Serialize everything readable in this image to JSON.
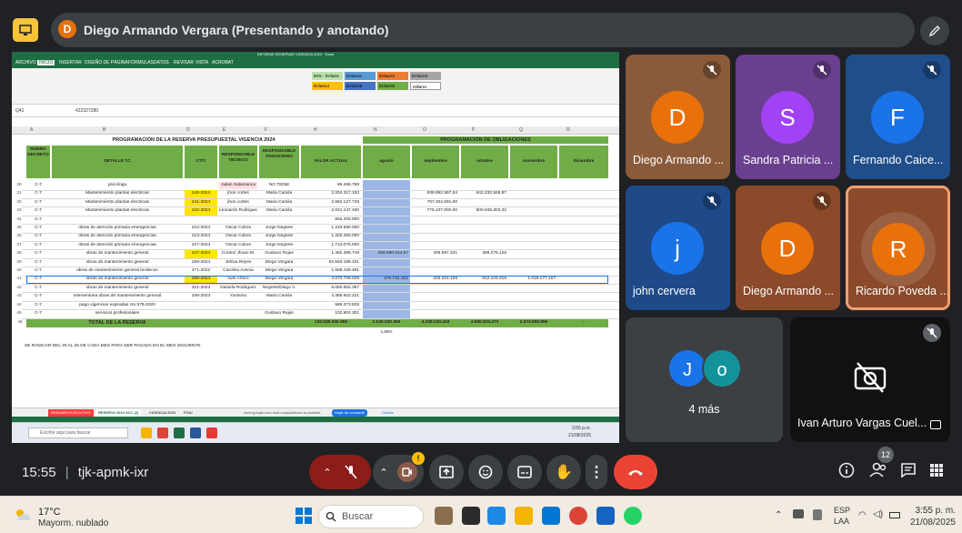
{
  "presenter": {
    "initial": "D",
    "text": "Diego Armando Vergara (Presentando y anotando)"
  },
  "excel": {
    "window_title": "INFORME RESERVAS VIGENCIA 2024 · Excel",
    "tabs": [
      "ARCHIVO",
      "INICIO",
      "INSERTAR",
      "DISEÑO DE PÁGINA",
      "FÓRMULAS",
      "DATOS",
      "REVISAR",
      "VISTA",
      "ACROBAT"
    ],
    "cell_ref": "Q41",
    "formula": "422327280",
    "styles": [
      {
        "label": "60% - Énfasis",
        "color": "#b9e1a9"
      },
      {
        "label": "Énfasis1",
        "color": "#5b9bd5"
      },
      {
        "label": "Énfasis2",
        "color": "#ed7d31"
      },
      {
        "label": "Énfasis3",
        "color": "#a5a5a5"
      },
      {
        "label": "Énfasis4",
        "color": "#ffc000"
      },
      {
        "label": "Énfasis5",
        "color": "#4472c4"
      },
      {
        "label": "Énfasis6",
        "color": "#70ad47"
      },
      {
        "label": "Millares",
        "color": "#ffffff"
      }
    ],
    "columns": [
      "A",
      "B",
      "D",
      "E",
      "F",
      "H",
      "N",
      "O",
      "P",
      "Q",
      "R"
    ],
    "title_left": "PROGRAMACIÓN DE LA RESERVA PRESUPUESTAL VIGENCIA 2024",
    "title_right": "PROGRAMACIÓN DE OBLIGACIONES",
    "headers": {
      "rubro": "RUBRO DECRETO",
      "detalle": "DETALLE TC",
      "cto": "CTO",
      "resp_tec": "RESPONSABLE TECNICO",
      "resp_fin": "RESPONSABLE FINANCIERO",
      "valor": "VALOR ACTUAL",
      "agosto": "agosto",
      "septiembre": "septiembre",
      "octubre": "octubre",
      "noviembre": "noviembre",
      "diciembre": "diciembre"
    },
    "rows": [
      {
        "n": "30",
        "rubro": "C-7",
        "detalle": "psicologa",
        "cto": "",
        "tec": "Julian Salamanca",
        "fin": "NO TIENE",
        "valor": "86.499.759",
        "ago": "",
        "sep": "",
        "oct": "",
        "nov": "",
        "dic": "",
        "hl": "red"
      },
      {
        "n": "31",
        "rubro": "C-7",
        "detalle": "Mantenimiento plantas electricas",
        "cto": "240-2024",
        "tec": "jhon cortes",
        "fin": "Maria Camila",
        "valor": "2.204.317.153",
        "ago": "",
        "sep": "638.892.557,54",
        "oct": "642.233.565,97",
        "nov": "",
        "dic": "",
        "hl": "yellow"
      },
      {
        "n": "32",
        "rubro": "C-7",
        "detalle": "Mantenimiento plantas electricas",
        "cto": "241-2024",
        "tec": "jhon cortes",
        "fin": "Maria Camila",
        "valor": "2.662.127.729",
        "ago": "",
        "sep": "797.304.591,00",
        "oct": "",
        "nov": "",
        "dic": "",
        "hl": "yellow"
      },
      {
        "n": "33",
        "rubro": "C-7",
        "detalle": "Mantenimiento plantas electricas",
        "cto": "242-2024",
        "tec": "Leonardo Rodriguez",
        "fin": "Maria Camila",
        "valor": "2.021.147.450",
        "ago": "",
        "sep": "776.107.000,00",
        "oct": "600.948.303,32",
        "nov": "",
        "dic": "",
        "hl": "yellow"
      },
      {
        "n": "34",
        "rubro": "C-7",
        "detalle": "",
        "cto": "",
        "tec": "",
        "fin": "",
        "valor": "663.200.000",
        "ago": "",
        "sep": "",
        "oct": "",
        "nov": "",
        "dic": "",
        "hl": ""
      },
      {
        "n": "35",
        "rubro": "C-7",
        "detalle": "obras de atención primaria emergencias",
        "cto": "212-2024",
        "tec": "Oscar Cobos",
        "fin": "Jorge Negrete",
        "valor": "1.233.590.000",
        "ago": "",
        "sep": "",
        "oct": "",
        "nov": "",
        "dic": "",
        "hl": ""
      },
      {
        "n": "36",
        "rubro": "C-7",
        "detalle": "obras de atención primaria emergencias",
        "cto": "213-2024",
        "tec": "Oscar Cobos",
        "fin": "Jorge Negrete",
        "valor": "1.202.250.000",
        "ago": "",
        "sep": "",
        "oct": "",
        "nov": "",
        "dic": "",
        "hl": ""
      },
      {
        "n": "37",
        "rubro": "C-7",
        "detalle": "obras de atención primaria emergencias",
        "cto": "217-2024",
        "tec": "Oscar Cobos",
        "fin": "Jorge Negrete",
        "valor": "1.713.075.000",
        "ago": "",
        "sep": "",
        "oct": "",
        "nov": "",
        "dic": "",
        "hl": ""
      },
      {
        "n": "38",
        "rubro": "C-7",
        "detalle": "obras de mantenimiento general",
        "cto": "247-2024",
        "tec": "Cortes/ Jhoan M.",
        "fin": "Gustavo Rojas",
        "valor": "1.482.386.749",
        "ago": "258.560.014,57",
        "sep": "406.597.321",
        "oct": "359.275.126",
        "nov": "",
        "dic": "",
        "hl": "yellow"
      },
      {
        "n": "39",
        "rubro": "C-7",
        "detalle": "obras de mantenimiento general",
        "cto": "259-2024",
        "tec": "Jehiva Reyes",
        "fin": "Diego Vergara",
        "valor": "53.593.188.331",
        "ago": "",
        "sep": "",
        "oct": "",
        "nov": "",
        "dic": "",
        "hl": ""
      },
      {
        "n": "40",
        "rubro": "C-7",
        "detalle": "obras de mantenimiento general fondecun",
        "cto": "271-2022",
        "tec": "Carolina Avenai",
        "fin": "Diego Vergara",
        "valor": "1.609.439.481",
        "ago": "",
        "sep": "",
        "oct": "",
        "nov": "",
        "dic": "",
        "hl": ""
      },
      {
        "n": "41",
        "rubro": "C-7",
        "detalle": "obras de mantenimiento general",
        "cto": "288-2024",
        "tec": "Ivan Arturo",
        "fin": "Diego Vergara",
        "valor": "4.070.708.029",
        "ago": "576.731.322",
        "sep": "433.324.109",
        "oct": "612.103.316",
        "nov": "1.018.177.157",
        "dic": "",
        "hl": "yellow"
      },
      {
        "n": "42",
        "rubro": "C-7",
        "detalle": "obras de mantenimiento general",
        "cto": "321-2023",
        "tec": "Daniela Rodriguez",
        "fin": "Negrete/Diego V.",
        "valor": "8.050.652.357",
        "ago": "",
        "sep": "",
        "oct": "",
        "nov": "",
        "dic": "",
        "hl": ""
      },
      {
        "n": "43",
        "rubro": "C-7",
        "detalle": "interventoria obras de mantenimiento general",
        "cto": "346-2023",
        "tec": "Yunismo",
        "fin": "Maria Camila",
        "valor": "4.365.922.221",
        "ago": "",
        "sep": "",
        "oct": "",
        "nov": "",
        "dic": "",
        "hl": ""
      },
      {
        "n": "44",
        "rubro": "C-7",
        "detalle": "pago vigencias expiradas cto 579-2020",
        "cto": "",
        "tec": "",
        "fin": "",
        "valor": "569.373.825",
        "ago": "",
        "sep": "",
        "oct": "",
        "nov": "",
        "dic": "",
        "hl": ""
      },
      {
        "n": "45",
        "rubro": "C-7",
        "detalle": "servicios profesionales",
        "cto": "",
        "tec": "",
        "fin": "Gustavo Rojas",
        "valor": "102.804.301",
        "ago": "",
        "sep": "",
        "oct": "",
        "nov": "",
        "dic": "",
        "hl": ""
      }
    ],
    "total": {
      "n": "46",
      "label": "TOTAL DE LA RESERVA",
      "valor": "130.635.056.355",
      "ago": "2.040.530.365",
      "sep": "4.208.040.443",
      "oct": "4.590.925.273",
      "nov": "2.574.908.896",
      "dic": "-"
    },
    "pct": "1,56%",
    "note": "SE RADICAR DEL 20 AL 25 DE CADA MES PARA SER PAGADA EN EL MES SIGUIENTE",
    "sheets": [
      "RESUMEN EJECUTIVO",
      "RESERVA 2024 SCC (2)",
      "VIGENCIA 2025",
      "POAI"
    ],
    "share_text": "meet.google.com está compartiendo tu pantalla.",
    "stop_share": "Dejar de compartir",
    "hide": "Ocultar",
    "search_placeholder": "Escribe aquí para buscar",
    "mini_time": "3:55 p.m.",
    "mini_date": "21/08/2025"
  },
  "participants": [
    {
      "initial": "D",
      "name": "Diego Armando ...",
      "color": "#8b5a3a",
      "avatar": "#e8710a",
      "muted": true
    },
    {
      "initial": "S",
      "name": "Sandra Patricia ...",
      "color": "#6b3f8f",
      "avatar": "#a142f4",
      "muted": true
    },
    {
      "initial": "F",
      "name": "Fernando Caice...",
      "color": "#1f4e8a",
      "avatar": "#1a73e8",
      "muted": true
    },
    {
      "initial": "j",
      "name": "john cervera",
      "color": "#1e4a8a",
      "avatar": "#1a73e8",
      "muted": true
    },
    {
      "initial": "D",
      "name": "Diego Armando ...",
      "color": "#8b4a2a",
      "avatar": "#e8710a",
      "muted": true
    },
    {
      "initial": "R",
      "name": "Ricardo Poveda ...",
      "color": "#8b4a2a",
      "avatar": "#e8710a",
      "muted": false
    }
  ],
  "more": {
    "label": "4 más",
    "a1": "J",
    "a2": "o"
  },
  "camera_off_name": "Ivan Arturo Vargas Cuel...",
  "meeting": {
    "time": "15:55",
    "code": "tjk-apmk-ixr",
    "people_count": "12"
  },
  "taskbar": {
    "temp": "17°C",
    "weather": "Mayorm. nublado",
    "search": "Buscar",
    "lang1": "ESP",
    "lang2": "LAA",
    "time": "3:55 p. m.",
    "date": "21/08/2025"
  },
  "colors": {
    "green": "#1f6e43",
    "header_green": "#70ad47",
    "end_call": "#ea4335"
  }
}
